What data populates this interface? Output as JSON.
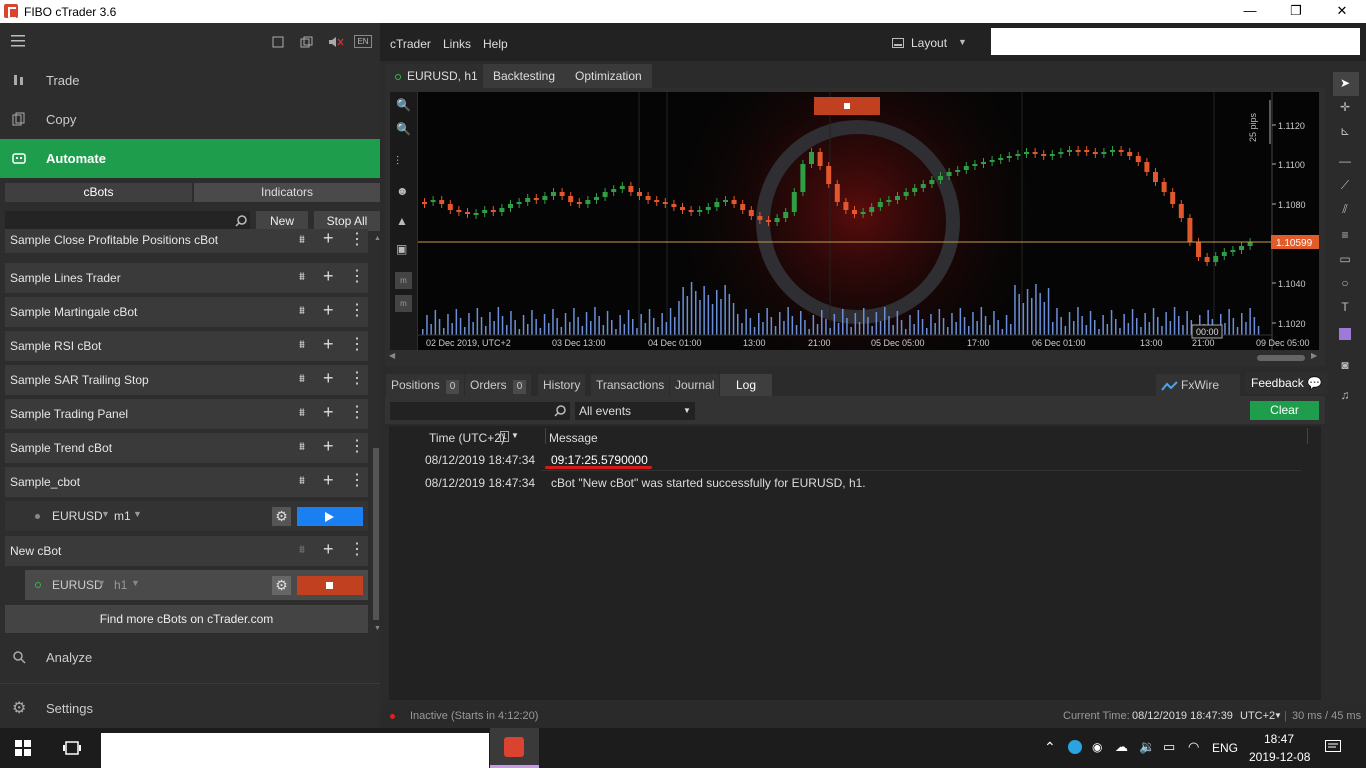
{
  "window": {
    "title": "FIBO cTrader 3.6",
    "minimize": "—",
    "maximize": "❐",
    "close": "✕"
  },
  "sidebar": {
    "lang": "EN",
    "nav": {
      "trade": "Trade",
      "copy": "Copy",
      "automate": "Automate",
      "analyze": "Analyze",
      "settings": "Settings"
    },
    "tabs": {
      "cbots": "cBots",
      "indicators": "Indicators"
    },
    "buttons": {
      "new": "New",
      "stop_all": "Stop All"
    },
    "bots": [
      {
        "name": "Sample Close Profitable Positions cBot"
      },
      {
        "name": "Sample Lines Trader"
      },
      {
        "name": "Sample Martingale cBot"
      },
      {
        "name": "Sample RSI cBot"
      },
      {
        "name": "Sample SAR Trailing Stop"
      },
      {
        "name": "Sample Trading Panel"
      },
      {
        "name": "Sample Trend cBot"
      },
      {
        "name": "Sample_cbot"
      }
    ],
    "instance1": {
      "symbol": "EURUSD",
      "timeframe": "m1"
    },
    "newbot": {
      "name": "New cBot"
    },
    "instance2": {
      "symbol": "EURUSD",
      "timeframe": "h1"
    },
    "find_more": "Find more cBots on cTrader.com"
  },
  "menu": {
    "ctrader": "cTrader",
    "links": "Links",
    "help": "Help",
    "layout": "Layout"
  },
  "chart_tabs": {
    "symbol": "EURUSD, h1",
    "backtesting": "Backtesting",
    "optimization": "Optimization"
  },
  "chart": {
    "current_price": "1.10599",
    "pips_label": "25 pips",
    "price_ticks": [
      "1.1120",
      "1.1100",
      "1.1080",
      "1.1060",
      "1.1040",
      "1.1020"
    ],
    "time_ticks": [
      "02 Dec 2019, UTC+2",
      "03 Dec 13:00",
      "04 Dec 01:00",
      "13:00",
      "21:00",
      "05 Dec 05:00",
      "17:00",
      "06 Dec 01:00",
      "13:00",
      "21:00",
      "09 Dec 05:00"
    ],
    "cursor_time": "00:00"
  },
  "bottom_tabs": {
    "positions": "Positions",
    "positions_count": "0",
    "orders": "Orders",
    "orders_count": "0",
    "history": "History",
    "transactions": "Transactions",
    "journal": "Journal",
    "log": "Log",
    "fxwire": "FxWire Pro",
    "feedback": "Feedback"
  },
  "log": {
    "filter": "All events",
    "clear": "Clear",
    "col_time": "Time (UTC+2)",
    "col_sort": "1",
    "col_message": "Message",
    "rows": [
      {
        "time": "08/12/2019 18:47:34",
        "message": "09:17:25.5790000"
      },
      {
        "time": "08/12/2019 18:47:34",
        "message": "cBot \"New cBot\" was started successfully for EURUSD, h1."
      }
    ]
  },
  "status": {
    "inactive": "Inactive (Starts in 4:12:20)",
    "current_time_label": "Current Time:",
    "current_time": "08/12/2019 18:47:39",
    "tz": "UTC+2",
    "latency": "30 ms / 45 ms"
  },
  "taskbar": {
    "lang": "ENG",
    "time": "18:47",
    "date": "2019-12-08"
  }
}
